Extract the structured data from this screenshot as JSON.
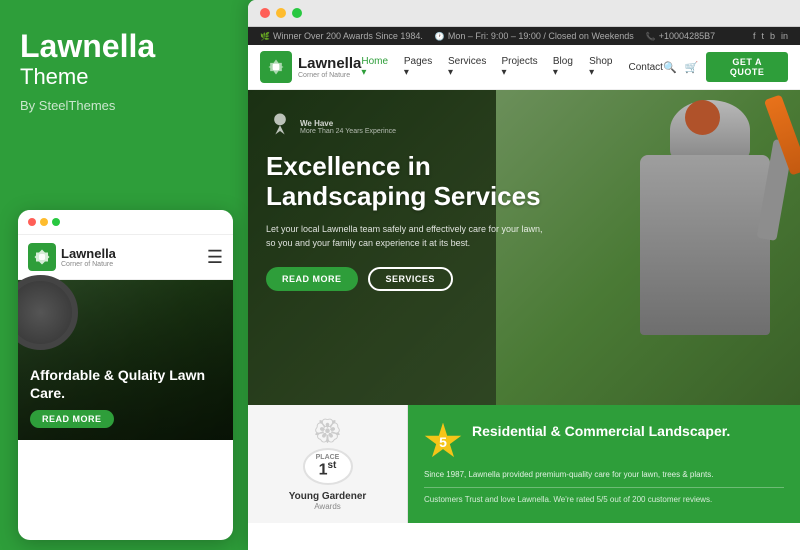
{
  "brand": {
    "title": "Lawnella",
    "subtitle": "Theme",
    "by": "By SteelThemes"
  },
  "mobile": {
    "logo_text": "Lawnella",
    "logo_sub": "Corner of Nature",
    "hero_title": "Affordable & Qulaity Lawn Care.",
    "hero_btn": "READ MORE"
  },
  "site": {
    "topbar": {
      "award": "Winner Over 200 Awards Since 1984.",
      "hours": "Mon – Fri: 9:00 – 19:00 / Closed on Weekends",
      "phone": "+10004285B7"
    },
    "navbar": {
      "logo_text": "Lawnella",
      "logo_sub": "Corner of Nature",
      "links": [
        "Home",
        "Pages",
        "Services",
        "Projects",
        "Blog",
        "Shop",
        "Contact"
      ],
      "quote_btn": "GET A QUOTE"
    },
    "hero": {
      "badge_title": "We Have",
      "badge_sub": "More Than 24 Years Experince",
      "main_title": "Excellence in\nLandscaping Services",
      "description": "Let your local Lawnella team safely and effectively care for your lawn, so you and your family can experience it at its best.",
      "btn_primary": "READ MORE",
      "btn_secondary": "SERVICES"
    },
    "award_card": {
      "place": "1st",
      "place_label": "PLACE",
      "title": "Young Gardener",
      "subtitle": "Awards"
    },
    "promo_card": {
      "star_number": "5",
      "title": "Residential & Commercial Landscaper.",
      "desc": "Since 1987, Lawnella provided premium-quality care for your lawn, trees & plants.",
      "review": "Customers Trust and love Lawnella. We're rated 5/5 out of 200 customer reviews."
    }
  },
  "colors": {
    "green": "#2e9e3a",
    "dark": "#222222",
    "light_gray": "#f5f5f5",
    "white": "#ffffff"
  }
}
